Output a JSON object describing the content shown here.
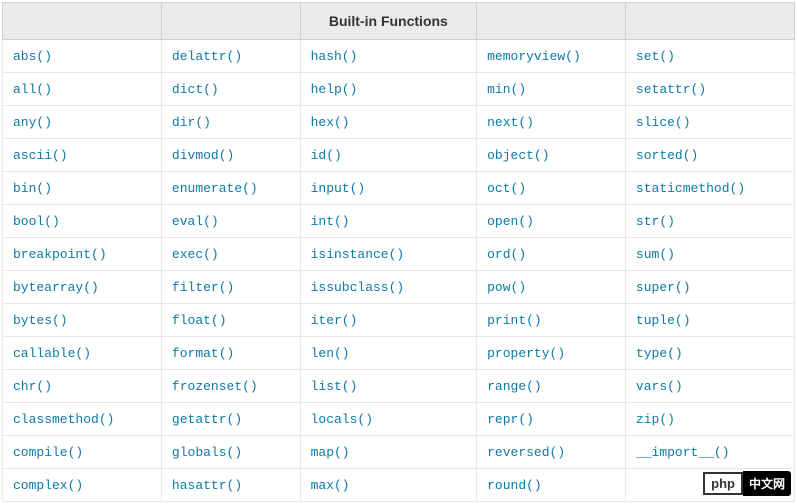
{
  "header": {
    "col1": "",
    "col2": "",
    "col3": "Built-in Functions",
    "col4": "",
    "col5": ""
  },
  "rows": [
    [
      "abs()",
      "delattr()",
      "hash()",
      "memoryview()",
      "set()"
    ],
    [
      "all()",
      "dict()",
      "help()",
      "min()",
      "setattr()"
    ],
    [
      "any()",
      "dir()",
      "hex()",
      "next()",
      "slice()"
    ],
    [
      "ascii()",
      "divmod()",
      "id()",
      "object()",
      "sorted()"
    ],
    [
      "bin()",
      "enumerate()",
      "input()",
      "oct()",
      "staticmethod()"
    ],
    [
      "bool()",
      "eval()",
      "int()",
      "open()",
      "str()"
    ],
    [
      "breakpoint()",
      "exec()",
      "isinstance()",
      "ord()",
      "sum()"
    ],
    [
      "bytearray()",
      "filter()",
      "issubclass()",
      "pow()",
      "super()"
    ],
    [
      "bytes()",
      "float()",
      "iter()",
      "print()",
      "tuple()"
    ],
    [
      "callable()",
      "format()",
      "len()",
      "property()",
      "type()"
    ],
    [
      "chr()",
      "frozenset()",
      "list()",
      "range()",
      "vars()"
    ],
    [
      "classmethod()",
      "getattr()",
      "locals()",
      "repr()",
      "zip()"
    ],
    [
      "compile()",
      "globals()",
      "map()",
      "reversed()",
      "__import__()"
    ],
    [
      "complex()",
      "hasattr()",
      "max()",
      "round()",
      ""
    ]
  ],
  "watermark": {
    "left": "php",
    "right": "中文网"
  }
}
